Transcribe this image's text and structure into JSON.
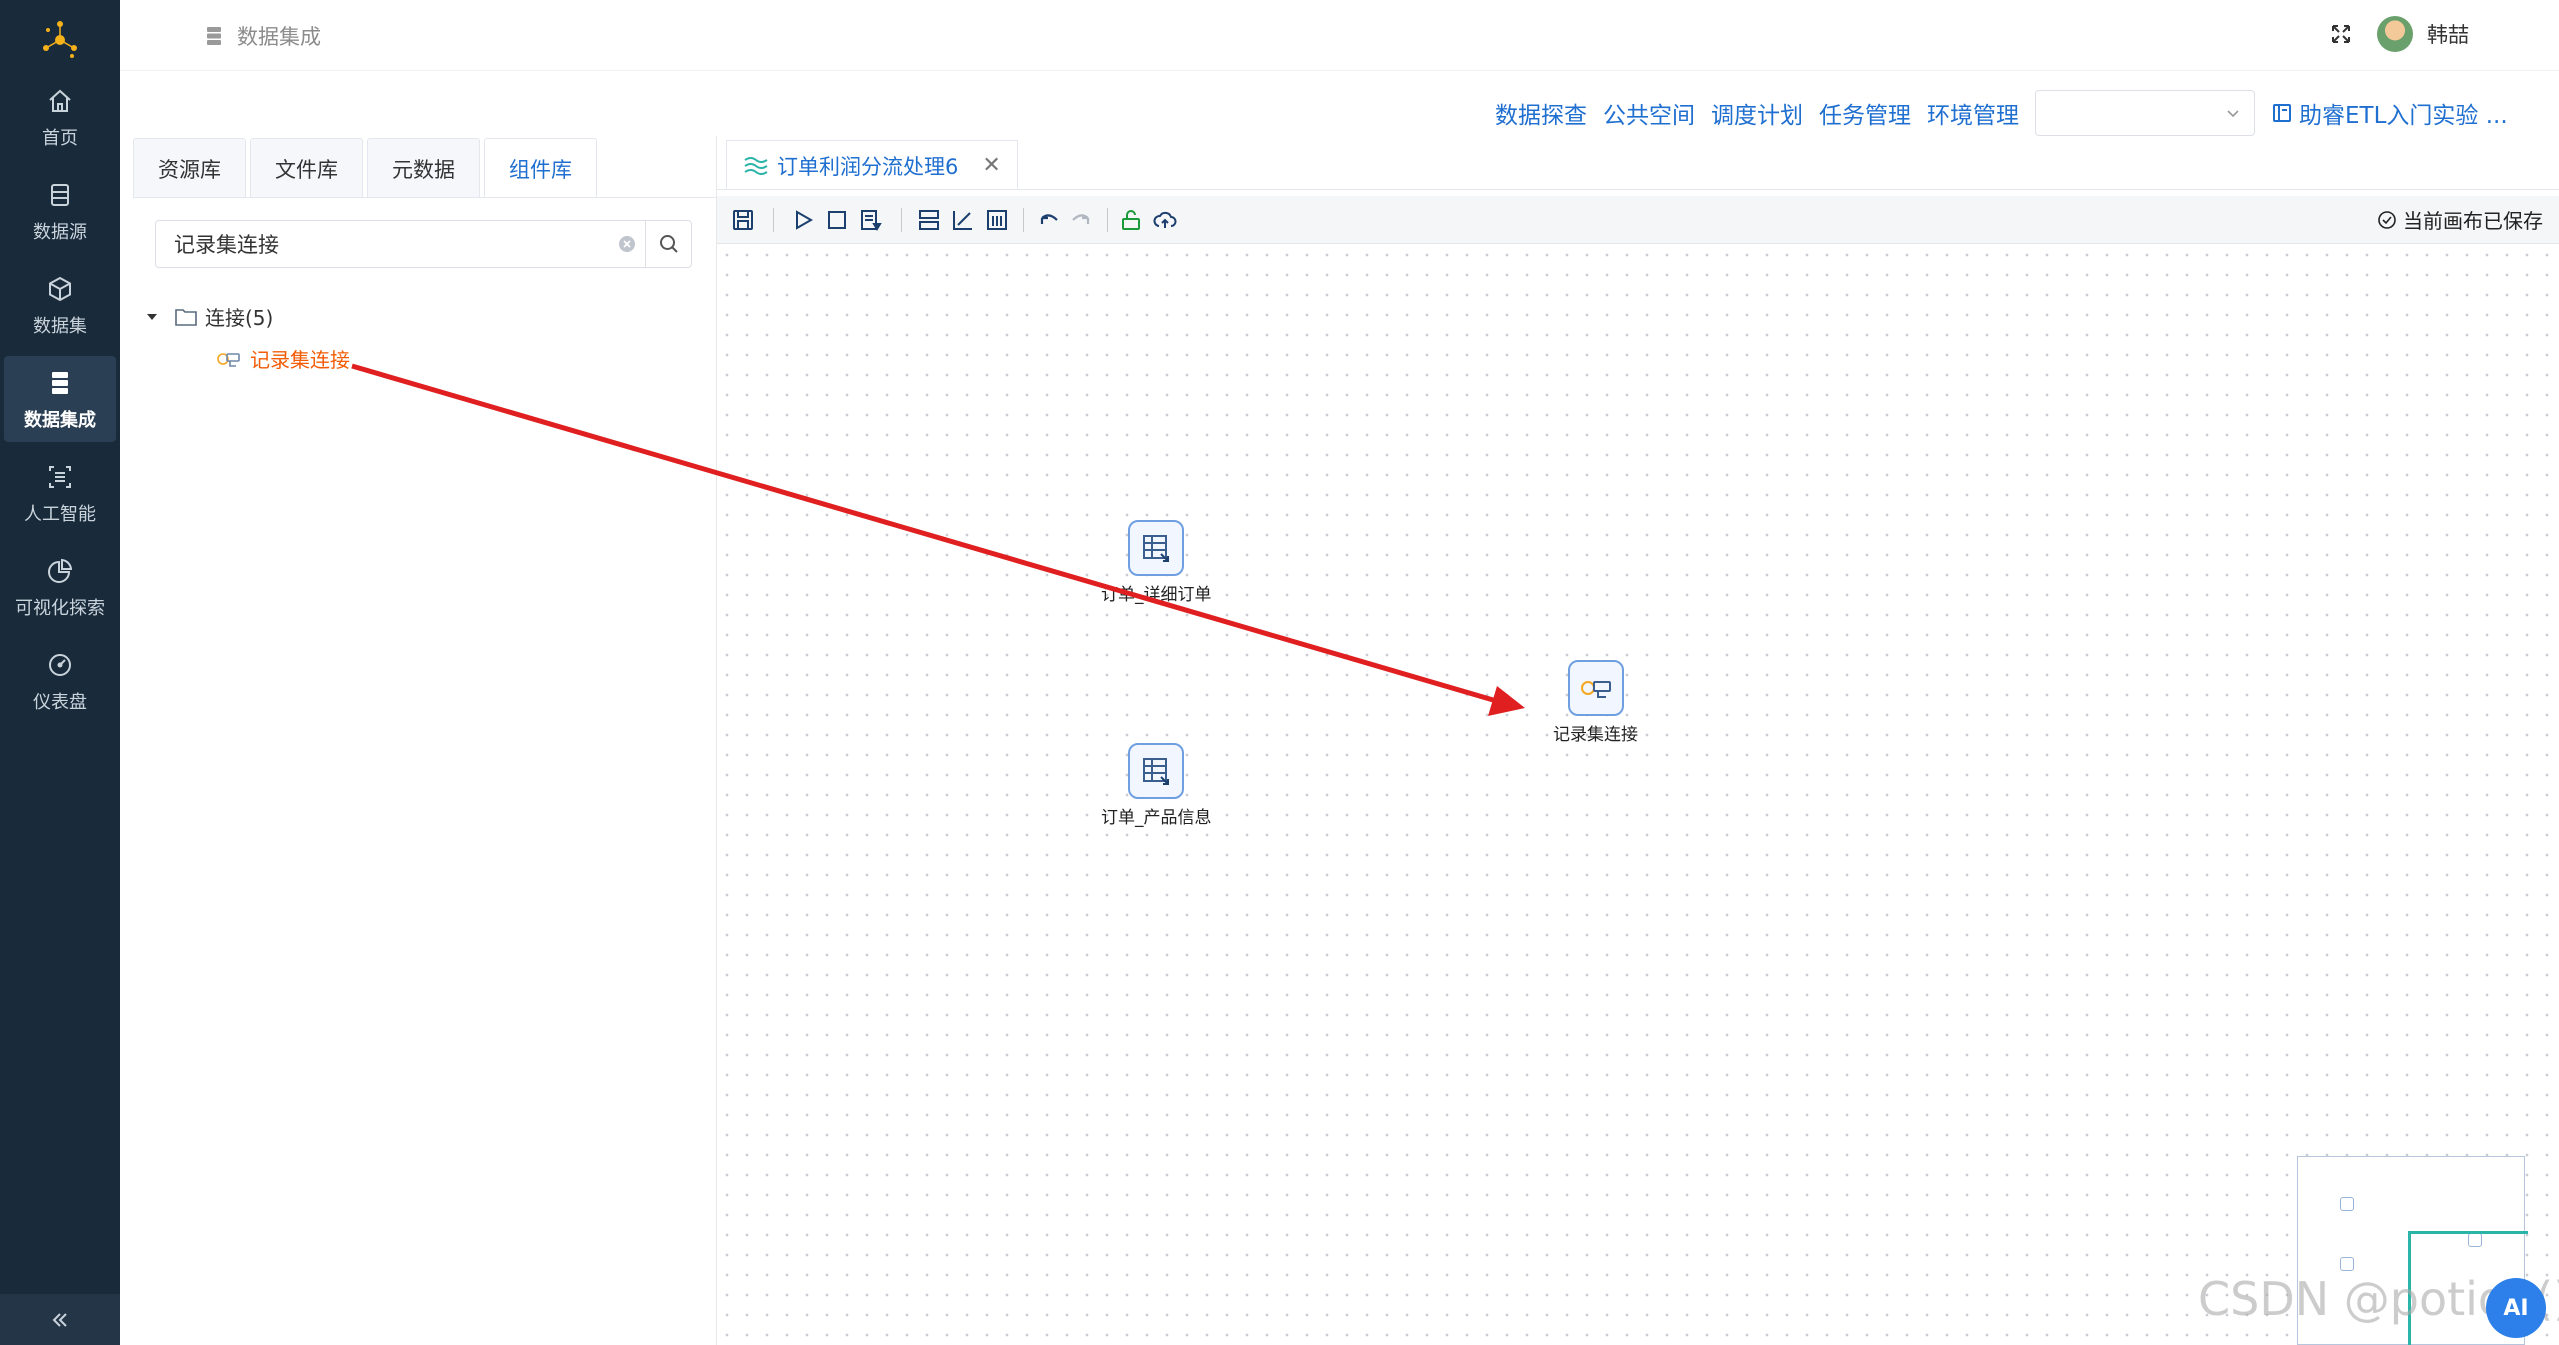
{
  "sidenav": {
    "items": [
      {
        "label": "首页",
        "icon": "home-icon"
      },
      {
        "label": "数据源",
        "icon": "datasource-icon"
      },
      {
        "label": "数据集",
        "icon": "cube-icon"
      },
      {
        "label": "数据集成",
        "icon": "integration-icon"
      },
      {
        "label": "人工智能",
        "icon": "ai-icon"
      },
      {
        "label": "可视化探索",
        "icon": "pie-chart-icon"
      },
      {
        "label": "仪表盘",
        "icon": "gauge-icon"
      }
    ],
    "active_label": "数据集成",
    "background": "#192a3a"
  },
  "header": {
    "breadcrumb": "数据集成",
    "user_name": "韩喆"
  },
  "quicklinks": [
    "数据探查",
    "公共空间",
    "调度计划",
    "任务管理",
    "环境管理"
  ],
  "env_select": {
    "value": ""
  },
  "guide_link": "助睿ETL入门实验 ...",
  "left_panel": {
    "tabs": [
      "资源库",
      "文件库",
      "元数据",
      "组件库"
    ],
    "active_tab": "组件库",
    "search_value": "记录集连接",
    "tree_root": "连接(5)",
    "tree_child": "记录集连接"
  },
  "canvas_tab": {
    "title": "订单利润分流处理6"
  },
  "toolbar": {
    "saved_status": "当前画布已保存"
  },
  "nodes": [
    {
      "label": "订单_详细订单",
      "icon": "table-input-icon"
    },
    {
      "label": "订单_产品信息",
      "icon": "table-input-icon"
    },
    {
      "label": "记录集连接",
      "icon": "recordset-join-icon"
    }
  ],
  "watermark": "CSDN @potion()",
  "float_button": "AI",
  "colors": {
    "accent": "#1f6fd0",
    "highlight": "#f25c05",
    "arrow": "#e02020",
    "minimap_view": "#2bb4a8"
  }
}
